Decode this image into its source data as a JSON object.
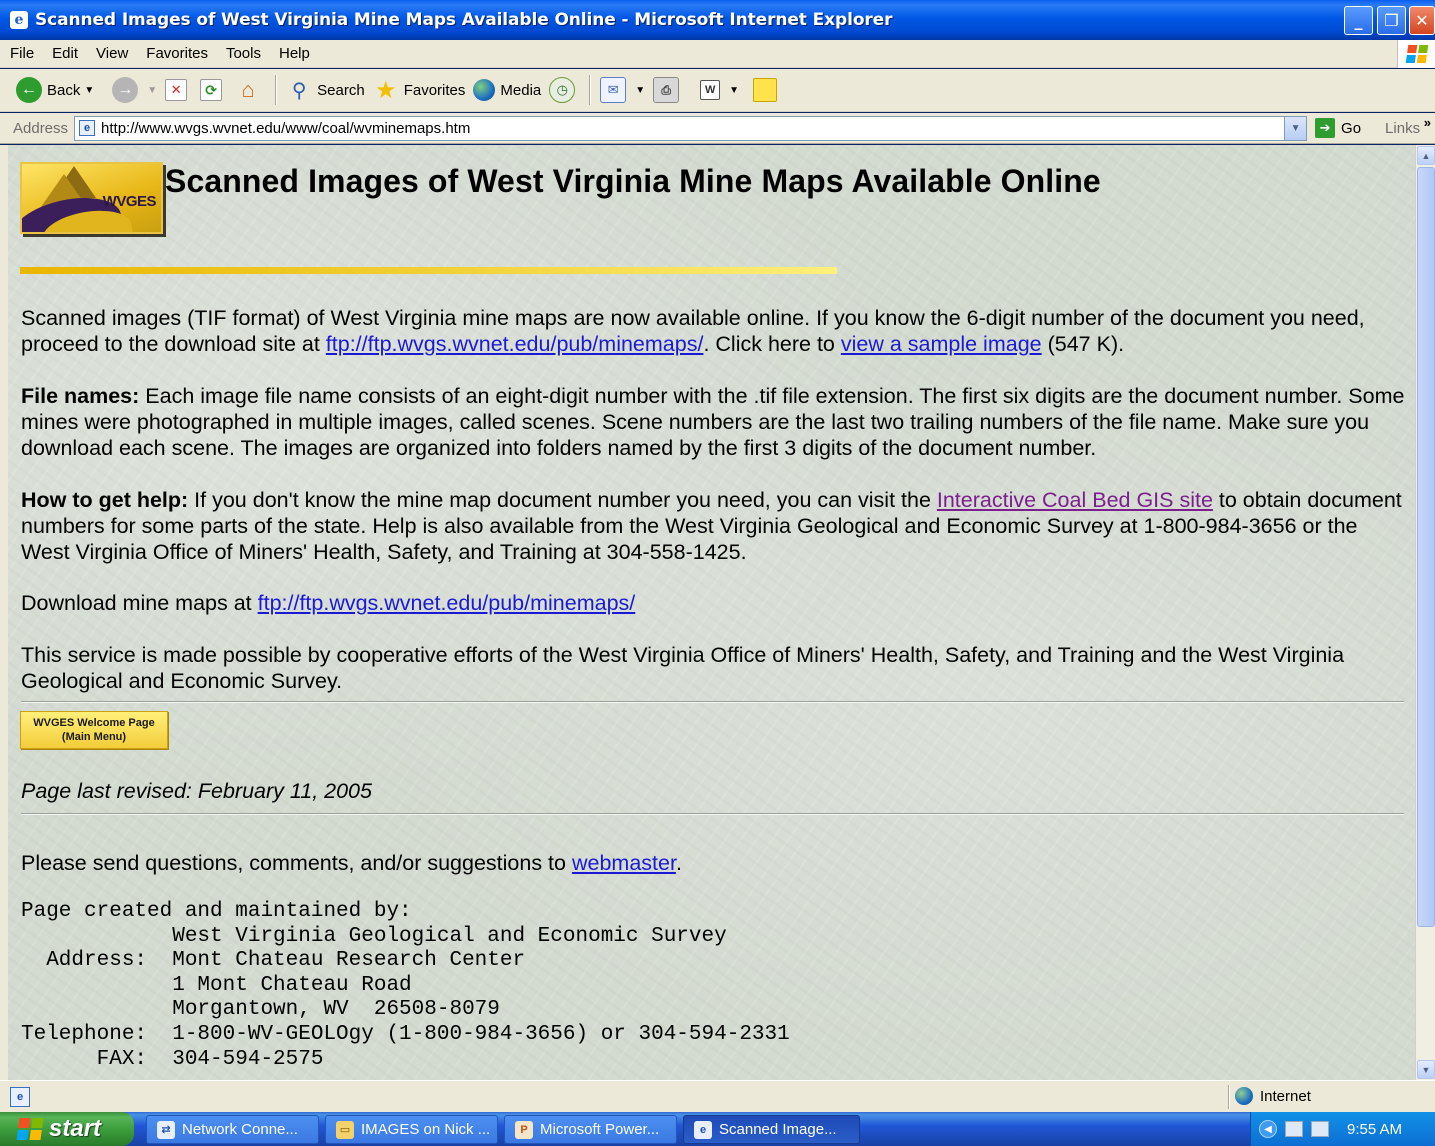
{
  "window": {
    "title": "Scanned Images of West Virginia Mine Maps Available Online - Microsoft Internet Explorer",
    "controls": {
      "minimize": "_",
      "maximize": "❐",
      "close": "✕"
    }
  },
  "menu": [
    "File",
    "Edit",
    "View",
    "Favorites",
    "Tools",
    "Help"
  ],
  "toolbar": {
    "back": "Back",
    "search": "Search",
    "favorites": "Favorites",
    "media": "Media"
  },
  "address": {
    "label": "Address",
    "url": "http://www.wvgs.wvnet.edu/www/coal/wvminemaps.htm",
    "go": "Go",
    "links": "Links"
  },
  "page": {
    "logo_text": "WVGES",
    "title": "Scanned Images of West Virginia Mine Maps Available Online",
    "intro": {
      "text1": "Scanned images (TIF format) of West Virginia mine maps are now available online. If you know the 6-digit number of the document you need, proceed to the download site at ",
      "link1": "ftp://ftp.wvgs.wvnet.edu/pub/minemaps/",
      "text2": ". Click here to ",
      "link2": "view a sample image",
      "text3": " (547 K)."
    },
    "file_names": {
      "label": "File names:",
      "text": " Each image file name consists of an eight-digit number with the .tif file extension. The first six digits are the document number. Some mines were photographed in multiple images, called scenes. Scene numbers are the last two trailing numbers of the file name. Make sure you download each scene. The images are organized into folders named by the first 3 digits of the document number."
    },
    "help": {
      "label": "How to get help:",
      "text1": " If you don't know the mine map document number you need, you can visit the ",
      "link": "Interactive Coal Bed GIS site",
      "text2": " to obtain document numbers for some parts of the state. Help is also available from the West Virginia Geological and Economic Survey at 1-800-984-3656 or the West Virginia Office of Miners' Health, Safety, and Training at 304-558-1425."
    },
    "download": {
      "text": "Download mine maps at ",
      "link": "ftp://ftp.wvgs.wvnet.edu/pub/minemaps/"
    },
    "service": "This service is made possible by cooperative efforts of the West Virginia Office of Miners' Health, Safety, and Training and the West Virginia Geological and Economic Survey.",
    "welcome_button": {
      "line1": "WVGES Welcome Page",
      "line2": "(Main Menu)"
    },
    "revised": "Page last revised: February 11, 2005",
    "questions": {
      "text": "Please send questions, comments, and/or suggestions to ",
      "link": "webmaster",
      "end": "."
    },
    "contact": "Page created and maintained by:\n            West Virginia Geological and Economic Survey\n  Address:  Mont Chateau Research Center\n            1 Mont Chateau Road\n            Morgantown, WV  26508-8079\nTelephone:  1-800-WV-GEOLOgy (1-800-984-3656) or 304-594-2331\n      FAX:  304-594-2575"
  },
  "status": {
    "zone": "Internet"
  },
  "taskbar": {
    "start": "start",
    "tasks": [
      "Network Conne...",
      "IMAGES on Nick ...",
      "Microsoft Power...",
      "Scanned Image..."
    ],
    "clock": "9:55 AM"
  }
}
